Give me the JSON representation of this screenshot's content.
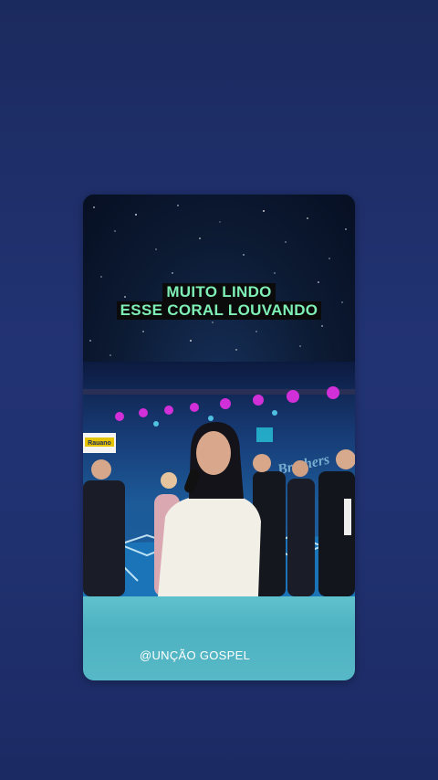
{
  "video": {
    "caption_lines": [
      "MUITO LINDO",
      "ESSE CORAL LOUVANDO"
    ],
    "watermark": "@UNÇÃO GOSPEL",
    "banner_text": "Brothers",
    "sign_text": "Rauano"
  }
}
